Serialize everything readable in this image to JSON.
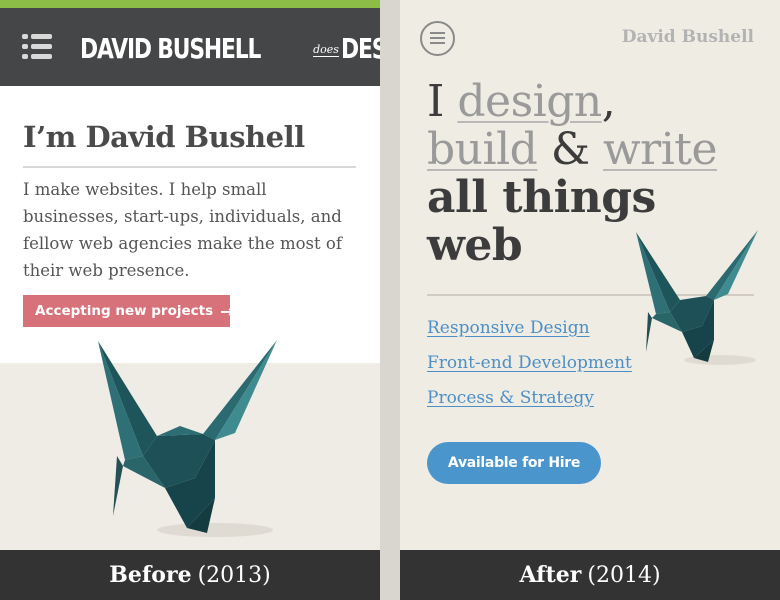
{
  "before": {
    "logo": {
      "part1": "DAVID BUSHELL",
      "does": "does",
      "part2": "DESIGN"
    },
    "title": "I’m David Bushell",
    "intro": "I make websites. I help small businesses, start-ups, individuals, and fellow web agencies make the most of their web presence.",
    "cta_label": "Accepting new projects",
    "cta_arrow": "→",
    "caption": {
      "label": "Before",
      "year": "(2013)"
    }
  },
  "after": {
    "site_name": "David Bushell",
    "hero": {
      "w1": "I",
      "w2": "design",
      "w3": ",",
      "w4": "build",
      "w5": "&",
      "w6": "write",
      "w7": "all things",
      "w8": "web"
    },
    "links": [
      "Responsive Design",
      "Front-end Development",
      "Process & Strategy"
    ],
    "cta_label": "Available for Hire",
    "caption": {
      "label": "After",
      "year": "(2014)"
    }
  },
  "colors": {
    "accent_green": "#8bbd47",
    "header_dark": "#454647",
    "cta_pink": "#d8727a",
    "link_blue": "#4b8fc6",
    "cta_blue": "#4b95cd",
    "crane_teal": "#1f5a60"
  },
  "icons": {
    "left_menu": "hamburger-list-icon",
    "right_menu": "circle-menu-icon",
    "crane": "origami-crane-illustration"
  }
}
